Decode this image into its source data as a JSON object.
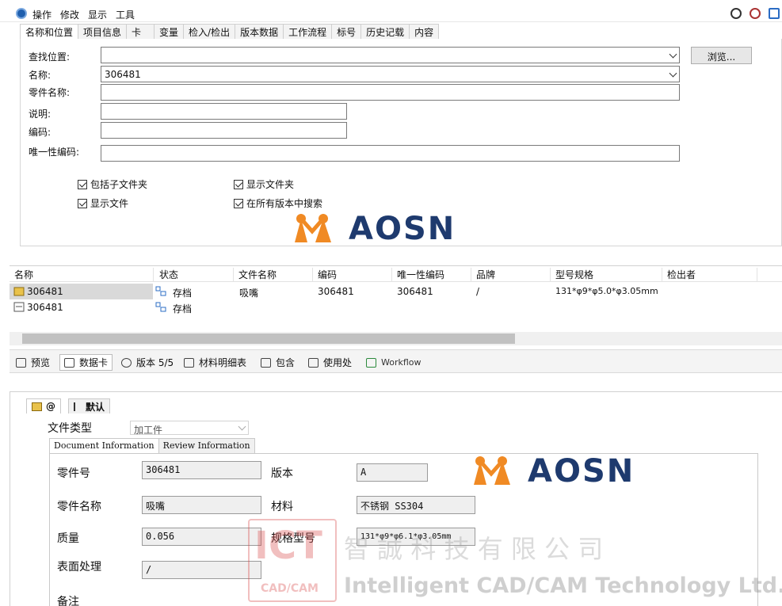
{
  "menu": {
    "items": [
      "操作",
      "修改",
      "显示",
      "工具"
    ]
  },
  "search_tabs": [
    "名称和位置",
    "项目信息",
    "卡",
    "变量",
    "检入/检出",
    "版本数据",
    "工作流程",
    "标号",
    "历史记载",
    "内容"
  ],
  "search_form": {
    "find_location_label": "查找位置:",
    "find_location_value": "",
    "name_label": "名称:",
    "name_value": "306481",
    "part_name_label": "零件名称:",
    "part_name_value": "",
    "desc_label": "说明:",
    "desc_value": "",
    "code_label": "编码:",
    "code_value": "",
    "unique_code_label": "唯一性编码:",
    "unique_code_value": "",
    "browse_label": "浏览..."
  },
  "checkboxes": {
    "include_subfolders": "包括子文件夹",
    "show_folders": "显示文件夹",
    "show_files": "显示文件",
    "search_all_versions": "在所有版本中搜索"
  },
  "logo": {
    "text": "AOSN",
    "accent_color": "#f08a24",
    "text_color": "#1e3a6e"
  },
  "results": {
    "columns": [
      "名称",
      "状态",
      "文件名称",
      "编码",
      "唯一性编码",
      "品牌",
      "型号规格",
      "检出者"
    ],
    "rows": [
      {
        "name": "306481",
        "state": "存档",
        "file_name": "吸嘴",
        "code": "306481",
        "unique_code": "306481",
        "brand": "/",
        "spec": "131*φ9*φ5.0*φ3.05mm",
        "checked_out_by": ""
      },
      {
        "name": "306481",
        "state": "存档",
        "file_name": "",
        "code": "",
        "unique_code": "",
        "brand": "",
        "spec": "",
        "checked_out_by": ""
      }
    ]
  },
  "bottom_tabs": [
    "预览",
    "数据卡",
    "版本 5/5",
    "材料明细表",
    "包含",
    "使用处",
    "Workflow"
  ],
  "card": {
    "config_tabs": [
      "@",
      "默认"
    ],
    "file_type_label": "文件类型",
    "file_type_value": "加工件",
    "info_tabs": [
      "Document Information",
      "Review Information"
    ],
    "fields": {
      "part_no_label": "零件号",
      "part_no": "306481",
      "version_label": "版本",
      "version": "A",
      "part_name_label": "零件名称",
      "part_name": "吸嘴",
      "material_label": "材料",
      "material": "不锈钢 SS304",
      "mass_label": "质量",
      "mass": "0.056",
      "spec_label": "规格型号",
      "spec": "131*φ9*φ6.1*φ3.05mm",
      "surface_label": "表面处理",
      "surface": "/",
      "remark_label": "备注"
    }
  },
  "watermark": {
    "logo_letters": "ICT",
    "logo_sub": "CAD/CAM",
    "cn": "智 誠 科 技 有 限 公 司",
    "en": "Intelligent CAD/CAM Technology Ltd."
  }
}
